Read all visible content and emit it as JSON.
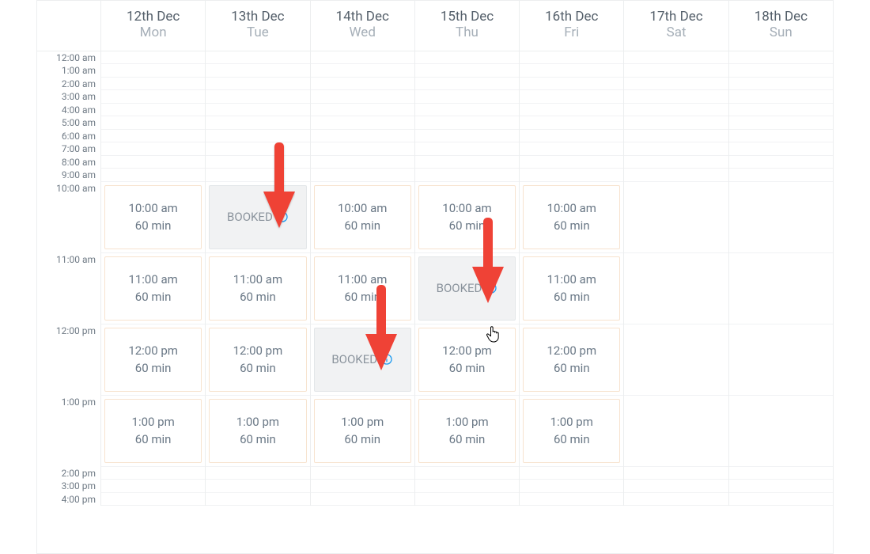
{
  "days": [
    {
      "date": "12th Dec",
      "dow": "Mon"
    },
    {
      "date": "13th Dec",
      "dow": "Tue"
    },
    {
      "date": "14th Dec",
      "dow": "Wed"
    },
    {
      "date": "15th Dec",
      "dow": "Thu"
    },
    {
      "date": "16th Dec",
      "dow": "Fri"
    },
    {
      "date": "17th Dec",
      "dow": "Sat"
    },
    {
      "date": "18th Dec",
      "dow": "Sun"
    }
  ],
  "early_hours": [
    "12:00 am",
    "1:00 am",
    "2:00 am",
    "3:00 am",
    "4:00 am",
    "5:00 am",
    "6:00 am",
    "7:00 am",
    "8:00 am",
    "9:00 am"
  ],
  "main_hours": [
    "10:00 am",
    "11:00 am",
    "12:00 pm",
    "1:00 pm"
  ],
  "late_hours": [
    "2:00 pm",
    "3:00 pm",
    "4:00 pm"
  ],
  "duration_label": "60 min",
  "booked_label": "BOOKED",
  "slots": {
    "d0": [
      {
        "time": "10:00 am",
        "booked": false
      },
      {
        "time": "11:00 am",
        "booked": false
      },
      {
        "time": "12:00 pm",
        "booked": false
      },
      {
        "time": "1:00 pm",
        "booked": false
      }
    ],
    "d1": [
      {
        "time": "10:00 am",
        "booked": true
      },
      {
        "time": "11:00 am",
        "booked": false
      },
      {
        "time": "12:00 pm",
        "booked": false
      },
      {
        "time": "1:00 pm",
        "booked": false
      }
    ],
    "d2": [
      {
        "time": "10:00 am",
        "booked": false
      },
      {
        "time": "11:00 am",
        "booked": false
      },
      {
        "time": "12:00 pm",
        "booked": true
      },
      {
        "time": "1:00 pm",
        "booked": false
      }
    ],
    "d3": [
      {
        "time": "10:00 am",
        "booked": false
      },
      {
        "time": "11:00 am",
        "booked": true
      },
      {
        "time": "12:00 pm",
        "booked": false
      },
      {
        "time": "1:00 pm",
        "booked": false
      }
    ],
    "d4": [
      {
        "time": "10:00 am",
        "booked": false
      },
      {
        "time": "11:00 am",
        "booked": false
      },
      {
        "time": "12:00 pm",
        "booked": false
      },
      {
        "time": "1:00 pm",
        "booked": false
      }
    ],
    "d5": [],
    "d6": []
  }
}
